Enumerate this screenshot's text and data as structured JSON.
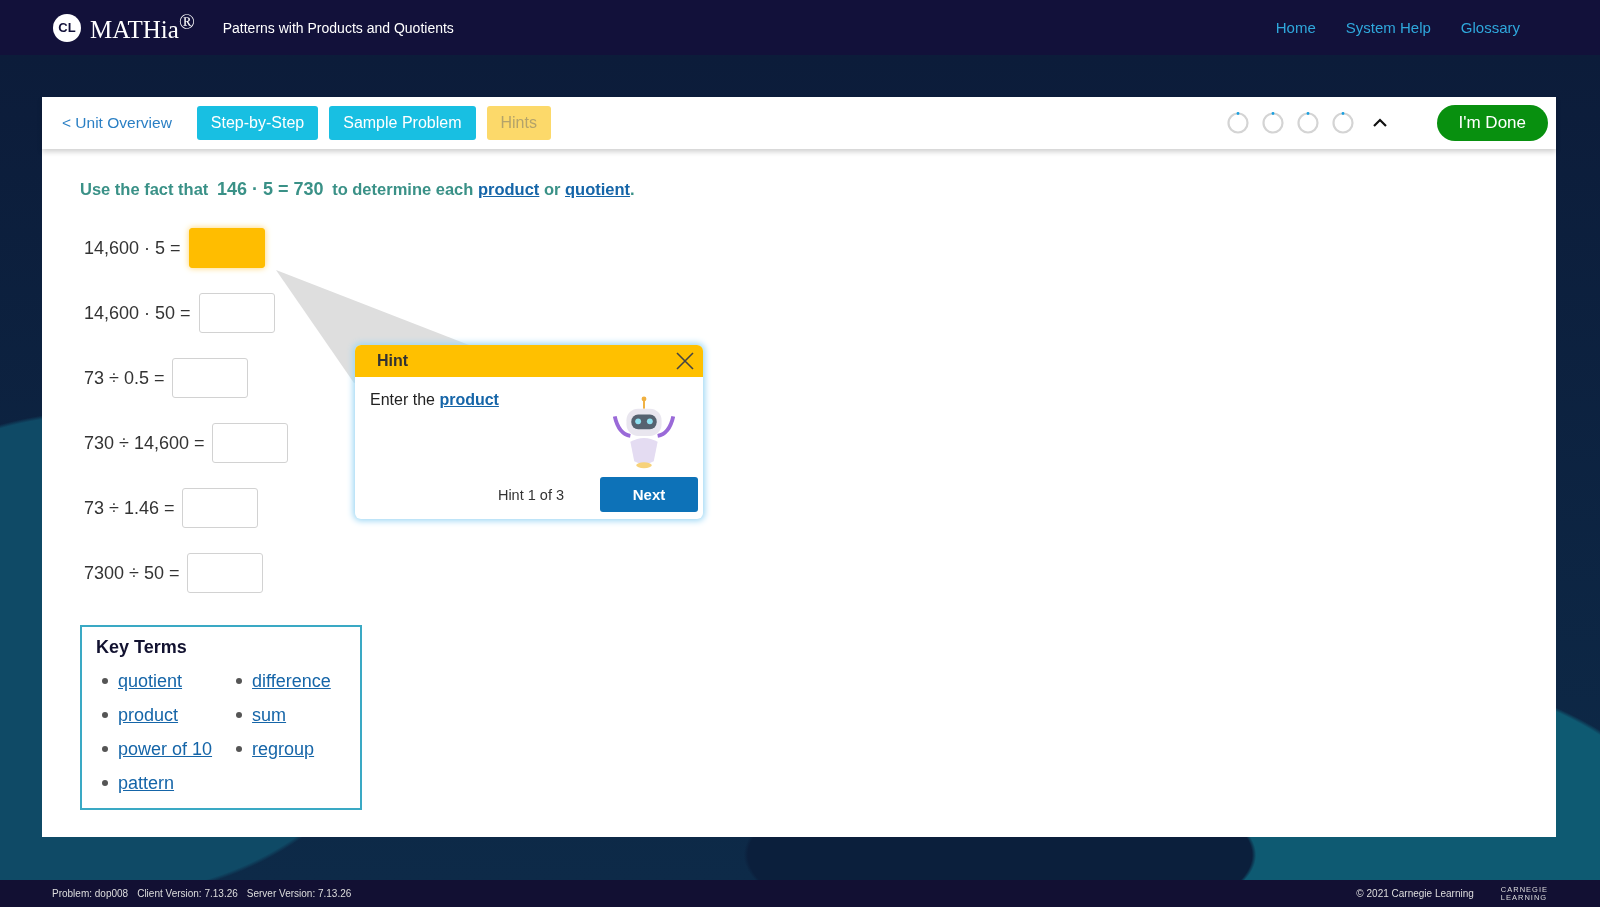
{
  "header": {
    "logo_mark": "CL",
    "logo_text": "MATHia$^{®}$",
    "lesson_title": "Patterns with Products and Quotients",
    "nav": [
      "Home",
      "System Help",
      "Glossary"
    ]
  },
  "toolbar": {
    "back_link": "< Unit Overview",
    "buttons": [
      {
        "label": "Step-by-Step",
        "disabled": false
      },
      {
        "label": "Sample Problem",
        "disabled": false
      },
      {
        "label": "Hints",
        "disabled": true
      }
    ],
    "done_button": "I'm Done"
  },
  "instruction": [
    {
      "kind": "text",
      "text": "Use the fact that"
    },
    {
      "kind": "math",
      "text": "146 · 5 = 730"
    },
    {
      "kind": "text",
      "text": "to determine each"
    },
    {
      "kind": "link",
      "text": "product"
    },
    {
      "kind": "text",
      "text": "or"
    },
    {
      "kind": "link",
      "text": "quotient"
    },
    {
      "kind": "text",
      "text": "."
    }
  ],
  "problems": [
    {
      "expression": "14,600 · 5 =",
      "selected": true
    },
    {
      "expression": "14,600 · 50 =",
      "selected": false
    },
    {
      "expression": "73 ÷ 0.5 =",
      "selected": false
    },
    {
      "expression": "730 ÷ 14,600 =",
      "selected": false
    },
    {
      "expression": "73 ÷ 1.46 =",
      "selected": false
    },
    {
      "expression": "7300 ÷ 50 =",
      "selected": false
    }
  ],
  "hint": {
    "title": "Hint",
    "text": "Enter the",
    "link": "product",
    "counter": "Hint 1 of 3",
    "next_button": "Next"
  },
  "key_terms": {
    "title": "Key Terms",
    "columns": [
      [
        "quotient",
        "product",
        "power of 10",
        "pattern"
      ],
      [
        "difference",
        "sum",
        "regroup"
      ]
    ]
  },
  "footer": {
    "info": [
      "Problem: dop008",
      "Client Version: 7.13.26",
      "Server Version: 7.13.26"
    ],
    "copyright": "© 2021 Carnegie Learning",
    "brand": [
      "CARNEGIE",
      "LEARNING"
    ]
  }
}
